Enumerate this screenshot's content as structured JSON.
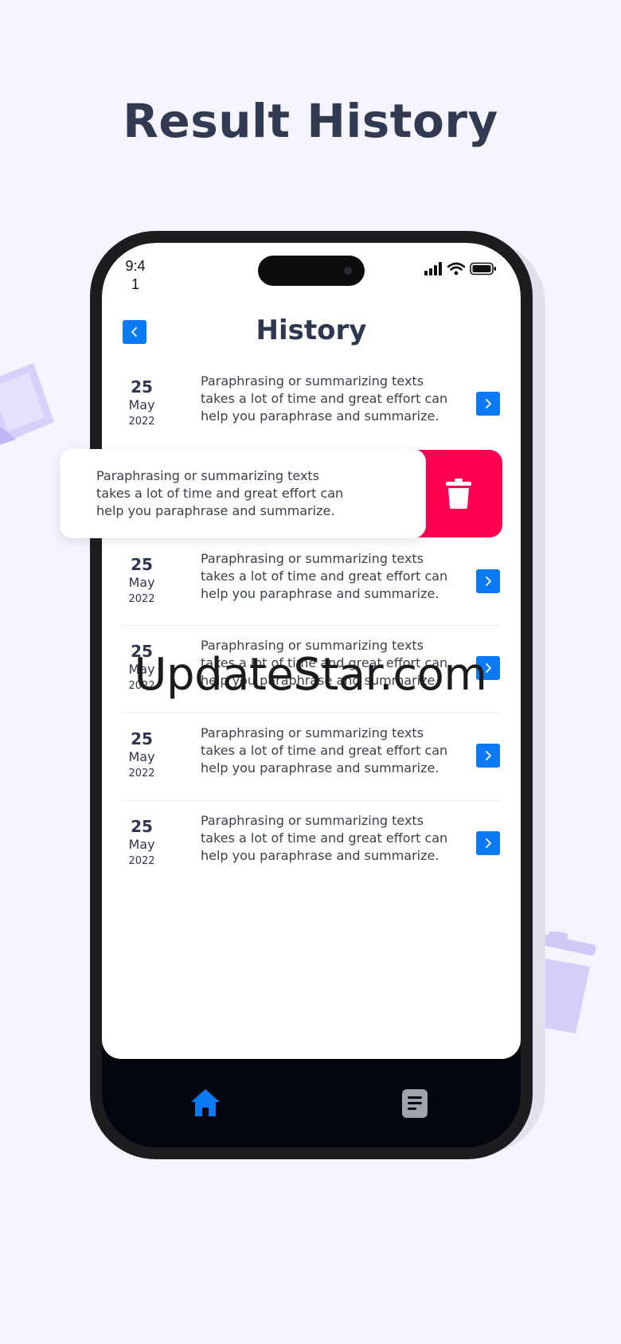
{
  "headline": "Result History",
  "status_bar": {
    "time": "9:4\n1"
  },
  "header": {
    "title": "History"
  },
  "items": [
    {
      "day": "25",
      "month": "May",
      "year": "2022",
      "text": "Paraphrasing or summarizing texts takes a lot of time and great effort can help you paraphrase and summarize."
    },
    {
      "day": "25",
      "month": "May",
      "year": "2022",
      "text": "Paraphrasing or summarizing texts takes a lot of time and great effort can help you paraphrase and summarize."
    },
    {
      "day": "25",
      "month": "May",
      "year": "2022",
      "text": "Paraphrasing or summarizing texts takes a lot of time and great effort can help you paraphrase and summarize."
    },
    {
      "day": "25",
      "month": "May",
      "year": "2022",
      "text": "Paraphrasing or summarizing texts takes a lot of time and great effort can help you paraphrase and summarize."
    },
    {
      "day": "25",
      "month": "May",
      "year": "2022",
      "text": "Paraphrasing or summarizing texts takes a lot of time and great effort can help you paraphrase and summarize."
    }
  ],
  "swiped_item": {
    "text": "Paraphrasing or summarizing texts takes a lot of time and great effort can help you paraphrase and summarize."
  },
  "watermark": "UpdateStar.com",
  "colors": {
    "accent": "#0a7bf4",
    "delete": "#ff0051",
    "title": "#2f3650",
    "background": "#f5f4fe",
    "nav_bar": "#02070f"
  },
  "icons": [
    "chevron-left-icon",
    "chevron-right-icon",
    "trash-icon",
    "home-icon",
    "document-icon",
    "signal-icon",
    "wifi-icon",
    "battery-icon"
  ]
}
